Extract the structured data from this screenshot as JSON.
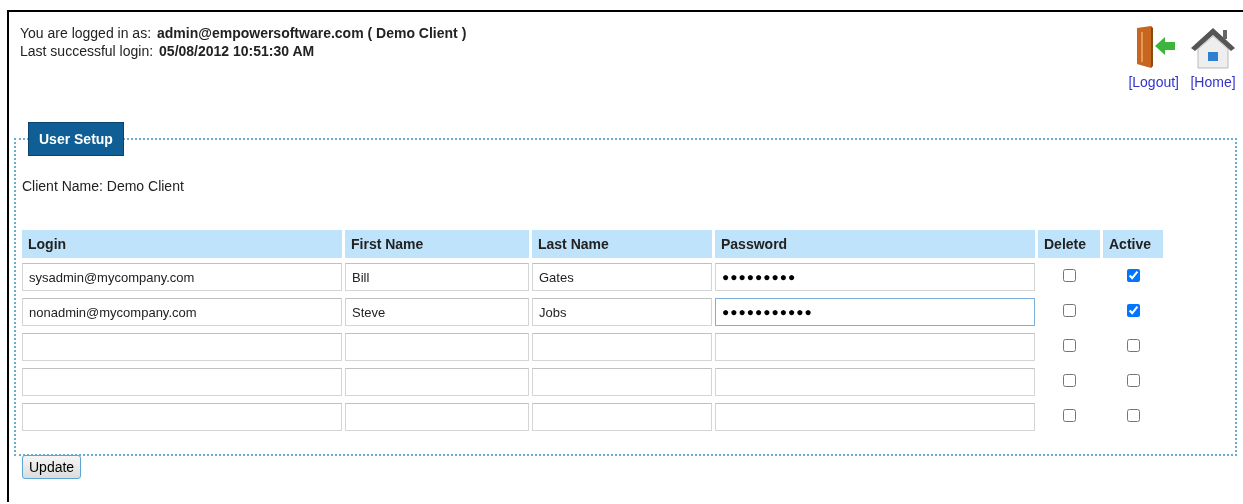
{
  "session": {
    "logged_in_label": "You are logged in as:",
    "logged_in_value": "admin@empowersoftware.com ( Demo Client )",
    "last_login_label": "Last successful login:",
    "last_login_value": "05/08/2012 10:51:30 AM"
  },
  "nav": [
    {
      "kind": "logout",
      "label": "[Logout]"
    },
    {
      "kind": "home",
      "label": "[Home]"
    }
  ],
  "section": {
    "title": "User Setup",
    "client_name": "Client Name: Demo Client"
  },
  "table": {
    "columns": [
      "Login",
      "First Name",
      "Last Name",
      "Password",
      "Delete",
      "Active"
    ],
    "rows": [
      {
        "login": "sysadmin@mycompany.com",
        "first_name": "Bill",
        "last_name": "Gates",
        "password": "●●●●●●●●●",
        "focused": false,
        "delete": false,
        "active": true
      },
      {
        "login": "nonadmin@mycompany.com",
        "first_name": "Steve",
        "last_name": "Jobs",
        "password": "●●●●●●●●●●●",
        "focused": true,
        "delete": false,
        "active": true
      },
      {
        "focused": false,
        "delete": false,
        "active": false
      },
      {
        "focused": false,
        "delete": false,
        "active": false
      },
      {
        "focused": false,
        "delete": false,
        "active": false
      }
    ]
  },
  "buttons": [
    "Update"
  ]
}
